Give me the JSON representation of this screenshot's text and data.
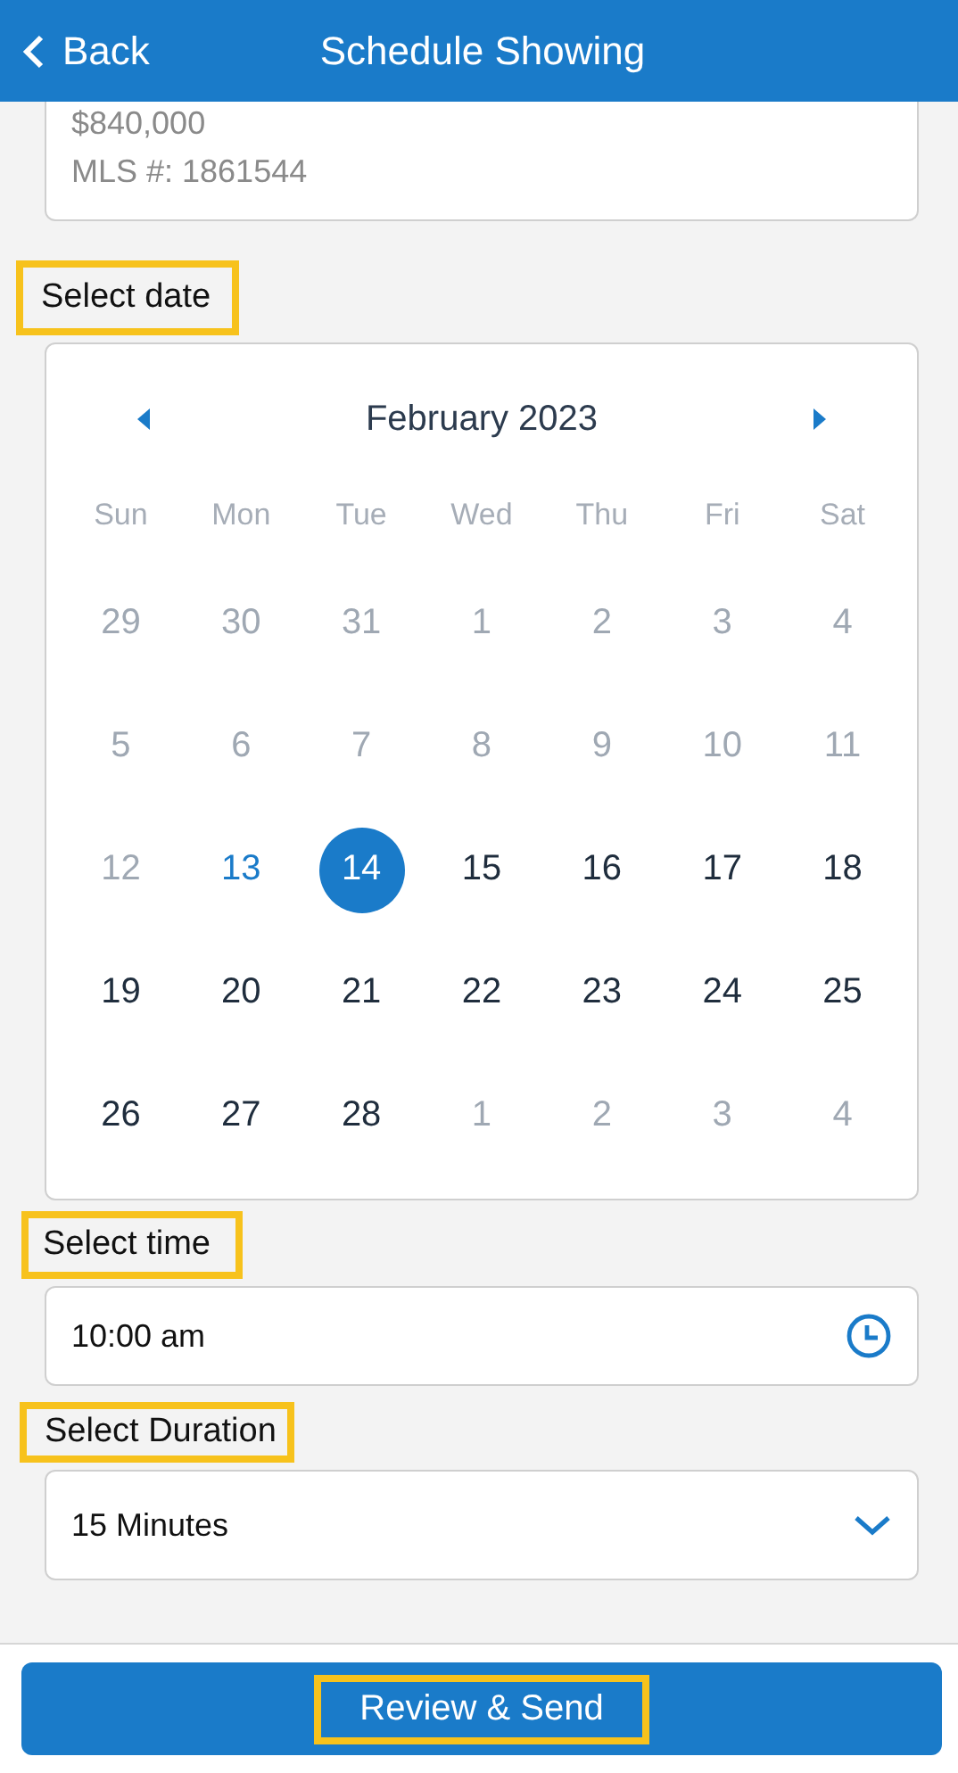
{
  "header": {
    "back_label": "Back",
    "title": "Schedule Showing"
  },
  "listing": {
    "price": "$840,000",
    "mls": "MLS #: 1861544"
  },
  "date_section": {
    "label": "Select date",
    "highlighted": true
  },
  "calendar": {
    "month": "February 2023",
    "weekdays": [
      "Sun",
      "Mon",
      "Tue",
      "Wed",
      "Thu",
      "Fri",
      "Sat"
    ],
    "days": [
      {
        "label": "29",
        "disabled": true,
        "today": false,
        "selected": false
      },
      {
        "label": "30",
        "disabled": true,
        "today": false,
        "selected": false
      },
      {
        "label": "31",
        "disabled": true,
        "today": false,
        "selected": false
      },
      {
        "label": "1",
        "disabled": true,
        "today": false,
        "selected": false
      },
      {
        "label": "2",
        "disabled": true,
        "today": false,
        "selected": false
      },
      {
        "label": "3",
        "disabled": true,
        "today": false,
        "selected": false
      },
      {
        "label": "4",
        "disabled": true,
        "today": false,
        "selected": false
      },
      {
        "label": "5",
        "disabled": true,
        "today": false,
        "selected": false
      },
      {
        "label": "6",
        "disabled": true,
        "today": false,
        "selected": false
      },
      {
        "label": "7",
        "disabled": true,
        "today": false,
        "selected": false
      },
      {
        "label": "8",
        "disabled": true,
        "today": false,
        "selected": false
      },
      {
        "label": "9",
        "disabled": true,
        "today": false,
        "selected": false
      },
      {
        "label": "10",
        "disabled": true,
        "today": false,
        "selected": false
      },
      {
        "label": "11",
        "disabled": true,
        "today": false,
        "selected": false
      },
      {
        "label": "12",
        "disabled": true,
        "today": false,
        "selected": false
      },
      {
        "label": "13",
        "disabled": false,
        "today": true,
        "selected": false
      },
      {
        "label": "14",
        "disabled": false,
        "today": false,
        "selected": true
      },
      {
        "label": "15",
        "disabled": false,
        "today": false,
        "selected": false
      },
      {
        "label": "16",
        "disabled": false,
        "today": false,
        "selected": false
      },
      {
        "label": "17",
        "disabled": false,
        "today": false,
        "selected": false
      },
      {
        "label": "18",
        "disabled": false,
        "today": false,
        "selected": false
      },
      {
        "label": "19",
        "disabled": false,
        "today": false,
        "selected": false
      },
      {
        "label": "20",
        "disabled": false,
        "today": false,
        "selected": false
      },
      {
        "label": "21",
        "disabled": false,
        "today": false,
        "selected": false
      },
      {
        "label": "22",
        "disabled": false,
        "today": false,
        "selected": false
      },
      {
        "label": "23",
        "disabled": false,
        "today": false,
        "selected": false
      },
      {
        "label": "24",
        "disabled": false,
        "today": false,
        "selected": false
      },
      {
        "label": "25",
        "disabled": false,
        "today": false,
        "selected": false
      },
      {
        "label": "26",
        "disabled": false,
        "today": false,
        "selected": false
      },
      {
        "label": "27",
        "disabled": false,
        "today": false,
        "selected": false
      },
      {
        "label": "28",
        "disabled": false,
        "today": false,
        "selected": false
      },
      {
        "label": "1",
        "disabled": true,
        "today": false,
        "selected": false
      },
      {
        "label": "2",
        "disabled": true,
        "today": false,
        "selected": false
      },
      {
        "label": "3",
        "disabled": true,
        "today": false,
        "selected": false
      },
      {
        "label": "4",
        "disabled": true,
        "today": false,
        "selected": false
      }
    ]
  },
  "time_section": {
    "label": "Select time",
    "highlighted": true,
    "value": "10:00 am"
  },
  "duration_section": {
    "label": "Select Duration",
    "highlighted": true,
    "value": "15 Minutes"
  },
  "submit": {
    "label": "Review & Send",
    "highlighted": true
  }
}
